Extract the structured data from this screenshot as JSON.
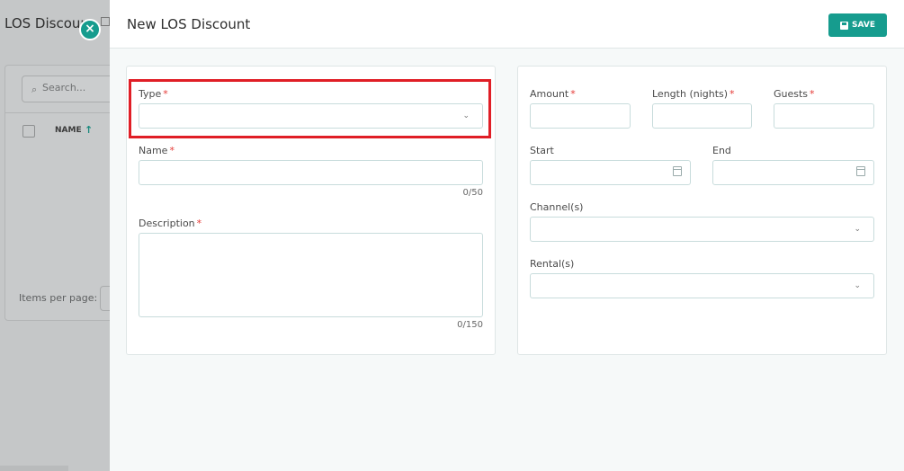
{
  "background": {
    "title": "LOS Discoun",
    "search_placeholder": "Search...",
    "column_name": "NAME",
    "items_per_page_label": "Items per page:"
  },
  "drawer": {
    "title": "New LOS Discount",
    "save_label": "SAVE"
  },
  "form": {
    "type": {
      "label": "Type",
      "value": ""
    },
    "name": {
      "label": "Name",
      "value": "",
      "counter": "0/50"
    },
    "description": {
      "label": "Description",
      "value": "",
      "counter": "0/150"
    },
    "amount": {
      "label": "Amount",
      "value": ""
    },
    "length": {
      "label": "Length (nights)",
      "value": ""
    },
    "guests": {
      "label": "Guests",
      "value": ""
    },
    "start": {
      "label": "Start",
      "value": ""
    },
    "end": {
      "label": "End",
      "value": ""
    },
    "channels": {
      "label": "Channel(s)",
      "value": ""
    },
    "rentals": {
      "label": "Rental(s)",
      "value": ""
    },
    "required_mark": "*"
  },
  "icons": {
    "close": "close-icon",
    "save": "save-icon",
    "search": "search-icon",
    "sort": "arrow-up-icon",
    "chevron": "chevron-down-icon",
    "calendar": "calendar-icon"
  },
  "colors": {
    "accent": "#169c8e",
    "required": "#e53935",
    "highlight": "#e01e26"
  }
}
